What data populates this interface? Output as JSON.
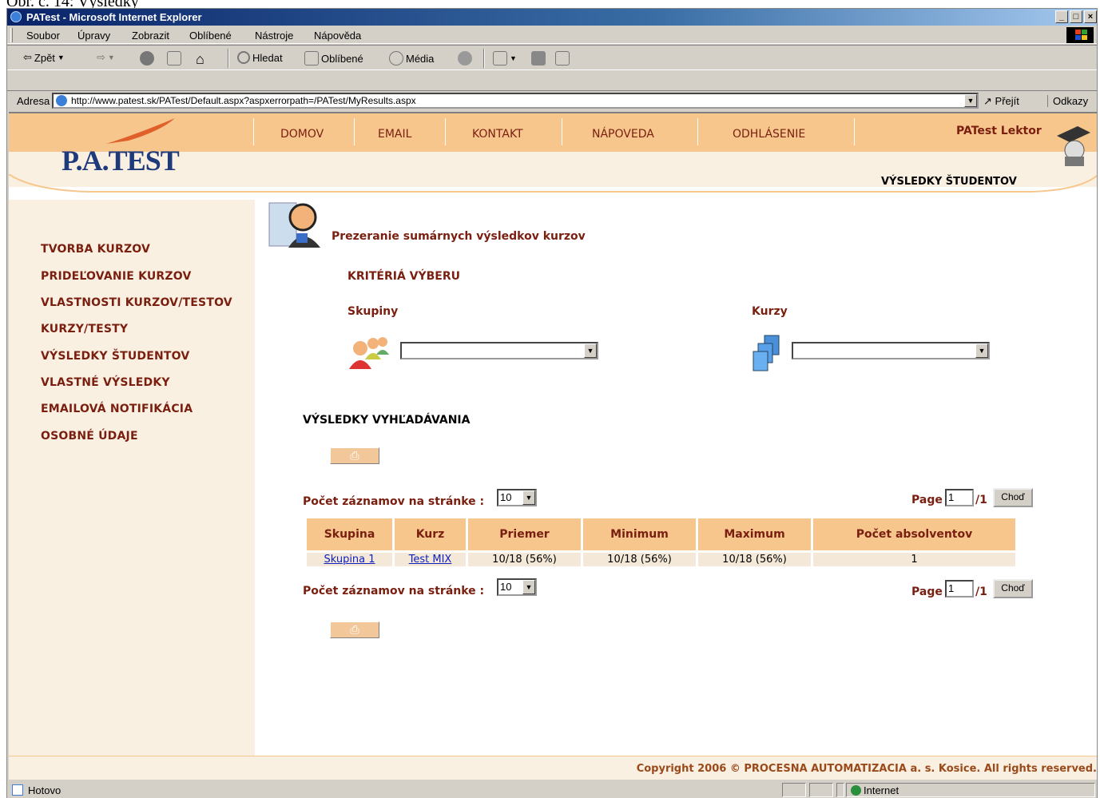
{
  "caption": "Obr. č. 14: Výsledky",
  "window": {
    "title": "PATest - Microsoft Internet Explorer",
    "controls": [
      "_",
      "□",
      "×"
    ]
  },
  "menu": [
    "Soubor",
    "Úpravy",
    "Zobrazit",
    "Oblíbené",
    "Nástroje",
    "Nápověda"
  ],
  "toolbar": {
    "back": "Zpět",
    "search": "Hledat",
    "favorites": "Oblíbené",
    "media": "Média"
  },
  "address": {
    "label": "Adresa",
    "url": "http://www.patest.sk/PATest/Default.aspx?aspxerrorpath=/PATest/MyResults.aspx",
    "go": "Přejít",
    "links": "Odkazy"
  },
  "site": {
    "logo": "P.A.TEST",
    "nav": [
      "DOMOV",
      "EMAIL",
      "KONTAKT",
      "NÁPOVEDA",
      "ODHLÁSENIE"
    ],
    "user": "PATest Lektor",
    "section": "VÝSLEDKY ŠTUDENTOV",
    "sidebar": [
      "TVORBA KURZOV",
      "PRIDEĽOVANIE KURZOV",
      "VLASTNOSTI KURZOV/TESTOV",
      "KURZY/TESTY",
      "VÝSLEDKY ŠTUDENTOV",
      "VLASTNÉ VÝSLEDKY",
      "EMAILOVÁ NOTIFIKÁCIA",
      "OSOBNÉ ÚDAJE"
    ],
    "copyright": "Copyright 2006 © PROCESNA AUTOMATIZACIA a. s. Kosice. All rights reserved."
  },
  "content": {
    "heading": "Prezeranie sumárnych výsledkov kurzov",
    "criteria": "KRITÉRIÁ VÝBERU",
    "groups_label": "Skupiny",
    "courses_label": "Kurzy",
    "groups_value": "",
    "courses_value": "",
    "results_title": "VÝSLEDKY VYHĽADÁVANIA",
    "per_page_label": "Počet záznamov na stránke :",
    "per_page_value": "10",
    "page_label": "Page",
    "page_value": "1",
    "page_total": "/1",
    "go_button": "Choď"
  },
  "table": {
    "headers": [
      "Skupina",
      "Kurz",
      "Priemer",
      "Minimum",
      "Maximum",
      "Počet absolventov"
    ],
    "rows": [
      [
        "Skupina 1",
        "Test MIX",
        "10/18 (56%)",
        "10/18 (56%)",
        "10/18 (56%)",
        "1"
      ]
    ]
  },
  "status": {
    "text": "Hotovo",
    "zone": "Internet"
  }
}
